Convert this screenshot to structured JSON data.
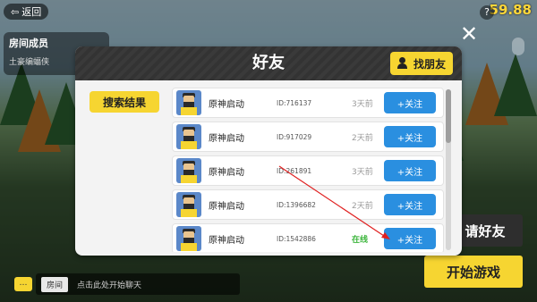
{
  "hud": {
    "back_label": "返回",
    "fps": "59.88",
    "help_icon": "question-icon",
    "close_icon": "close-icon",
    "mic_icon": "microphone-icon"
  },
  "members": {
    "title": "房间成员",
    "player_name": "土豪编蝠侠"
  },
  "buttons": {
    "invite": "请好友",
    "start": "开始游戏"
  },
  "chat": {
    "channel": "房间",
    "placeholder": "点击此处开始聊天"
  },
  "modal": {
    "title": "好友",
    "find_friend": "找朋友",
    "search_tab": "搜索结果",
    "results": [
      {
        "nickname": "原神启动",
        "id": "ID:716137",
        "status": "3天前",
        "online": false,
        "follow": "+关注"
      },
      {
        "nickname": "原神启动",
        "id": "ID:917029",
        "status": "2天前",
        "online": false,
        "follow": "+关注"
      },
      {
        "nickname": "原神启动",
        "id": "ID:261891",
        "status": "3天前",
        "online": false,
        "follow": "+关注"
      },
      {
        "nickname": "原神启动",
        "id": "ID:1396682",
        "status": "2天前",
        "online": false,
        "follow": "+关注"
      },
      {
        "nickname": "原神启动",
        "id": "ID:1542886",
        "status": "在线",
        "online": true,
        "follow": "+关注"
      }
    ]
  },
  "colors": {
    "accent_yellow": "#f6d531",
    "follow_blue": "#2a8fe0",
    "online_green": "#3bb53b",
    "fps_yellow": "#ffd83a"
  }
}
